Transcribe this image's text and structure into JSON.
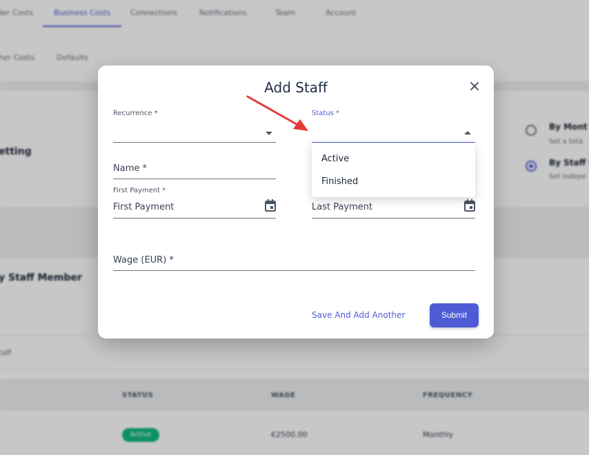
{
  "background": {
    "top_tabs": [
      {
        "label": "der Costs",
        "active": false
      },
      {
        "label": "Business Costs",
        "active": true
      },
      {
        "label": "Connections",
        "active": false
      },
      {
        "label": "Notifications",
        "active": false
      },
      {
        "label": "Team",
        "active": false
      },
      {
        "label": "Account",
        "active": false
      }
    ],
    "sub_tabs": [
      "her Costs",
      "Defaults"
    ],
    "setting_heading": "etting",
    "options": [
      {
        "title": "By Mont",
        "subtitle": "Set a tota",
        "checked": false
      },
      {
        "title": "By Staff M",
        "subtitle": "Set indepe",
        "checked": true
      }
    ],
    "section_heading": "y Staff Member",
    "list_label": "taff",
    "table": {
      "headers": [
        "STATUS",
        "WAGE",
        "FREQUENCY"
      ],
      "row": {
        "status": "Active",
        "wage": "€2500.00",
        "frequency": "Monthly"
      }
    }
  },
  "modal": {
    "title": "Add Staff",
    "recurrence": {
      "label": "Recurrence *",
      "value": ""
    },
    "status": {
      "label": "Status *",
      "value": "",
      "open": true,
      "options": [
        "Active",
        "Finished"
      ]
    },
    "name": {
      "placeholder": "Name *"
    },
    "first_payment": {
      "label": "First Payment *",
      "placeholder": "First Payment"
    },
    "last_payment": {
      "placeholder": "Last Payment"
    },
    "wage": {
      "placeholder": "Wage (EUR) *"
    },
    "save_another_label": "Save And Add Another",
    "submit_label": "Submit"
  },
  "colors": {
    "accent": "#4f5bd5",
    "status_active": "#10b981",
    "annotation_arrow": "#e53935"
  },
  "icons": {
    "close": "close-icon",
    "calendar": "calendar-icon",
    "dropdown": "chevron-down-icon"
  }
}
